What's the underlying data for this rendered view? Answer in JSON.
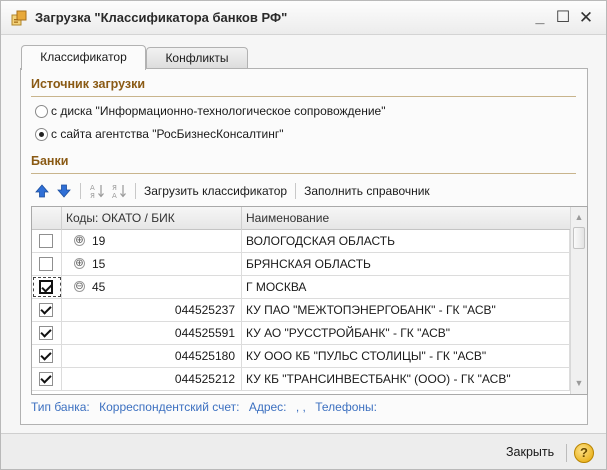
{
  "window": {
    "title": "Загрузка \"Классификатора банков РФ\""
  },
  "tabs": [
    {
      "label": "Классификатор",
      "active": true
    },
    {
      "label": "Конфликты",
      "active": false
    }
  ],
  "source": {
    "title": "Источник загрузки",
    "options": [
      {
        "label": "с диска \"Информационно-технологическое сопровождение\"",
        "selected": false
      },
      {
        "label": "с сайта агентства \"РосБизнесКонсалтинг\"",
        "selected": true
      }
    ]
  },
  "banks": {
    "title": "Банки",
    "toolbar": {
      "load_label": "Загрузить классификатор",
      "fill_label": "Заполнить справочник"
    },
    "columns": {
      "code": "Коды: ОКАТО / БИК",
      "name": "Наименование"
    },
    "rows": [
      {
        "checked": false,
        "code": "19",
        "name": "ВОЛОГОДСКАЯ ОБЛАСТЬ",
        "group": true,
        "expander": "⊕"
      },
      {
        "checked": false,
        "code": "15",
        "name": "БРЯНСКАЯ ОБЛАСТЬ",
        "group": true,
        "expander": "⊕"
      },
      {
        "checked": true,
        "code": "45",
        "name": "Г МОСКВА",
        "group": true,
        "expander": "⊖"
      },
      {
        "checked": true,
        "code": "044525237",
        "name": "КУ ПАО \"МЕЖТОПЭНЕРГОБАНК\" - ГК \"АСВ\"",
        "group": false
      },
      {
        "checked": true,
        "code": "044525591",
        "name": "КУ АО \"РУССТРОЙБАНК\" - ГК \"АСВ\"",
        "group": false
      },
      {
        "checked": true,
        "code": "044525180",
        "name": "КУ ООО КБ \"ПУЛЬС СТОЛИЦЫ\" - ГК \"АСВ\"",
        "group": false
      },
      {
        "checked": true,
        "code": "044525212",
        "name": "КУ КБ \"ТРАНСИНВЕСТБАНК\" (ООО) - ГК \"АСВ\"",
        "group": false
      }
    ],
    "info": {
      "type_label": "Тип банка:",
      "account_label": "Корреспондентский счет:",
      "address_label": "Адрес:",
      "address_value": ", ,",
      "phones_label": "Телефоны:"
    }
  },
  "footer": {
    "close_label": "Закрыть",
    "help_label": "?"
  },
  "colors": {
    "section": "#8a5a14",
    "link": "#3c70c0",
    "arrow_up": "#2f6fd6"
  }
}
